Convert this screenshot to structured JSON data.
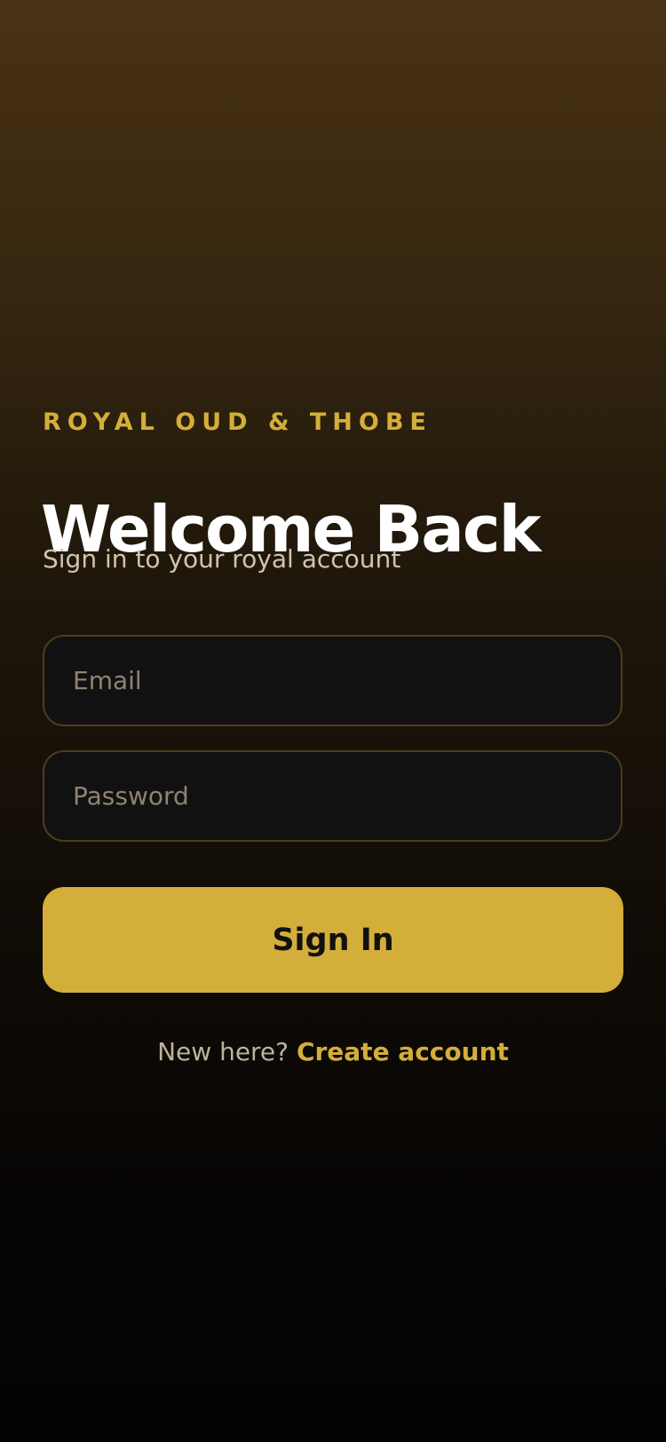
{
  "login": {
    "brand": "ROYAL OUD & THOBE",
    "title": "Welcome Back",
    "subtitle": "Sign in to your royal account",
    "email": {
      "placeholder": "Email",
      "value": ""
    },
    "password": {
      "placeholder": "Password",
      "value": ""
    },
    "sign_in_label": "Sign In",
    "footer": {
      "prompt": "New here?",
      "link_label": "Create account"
    }
  },
  "colors": {
    "accent": "#d4ae3a",
    "background_top": "#4a3214",
    "background_bottom": "#030303",
    "field_background": "#111111",
    "field_border": "#4d3d1c"
  }
}
